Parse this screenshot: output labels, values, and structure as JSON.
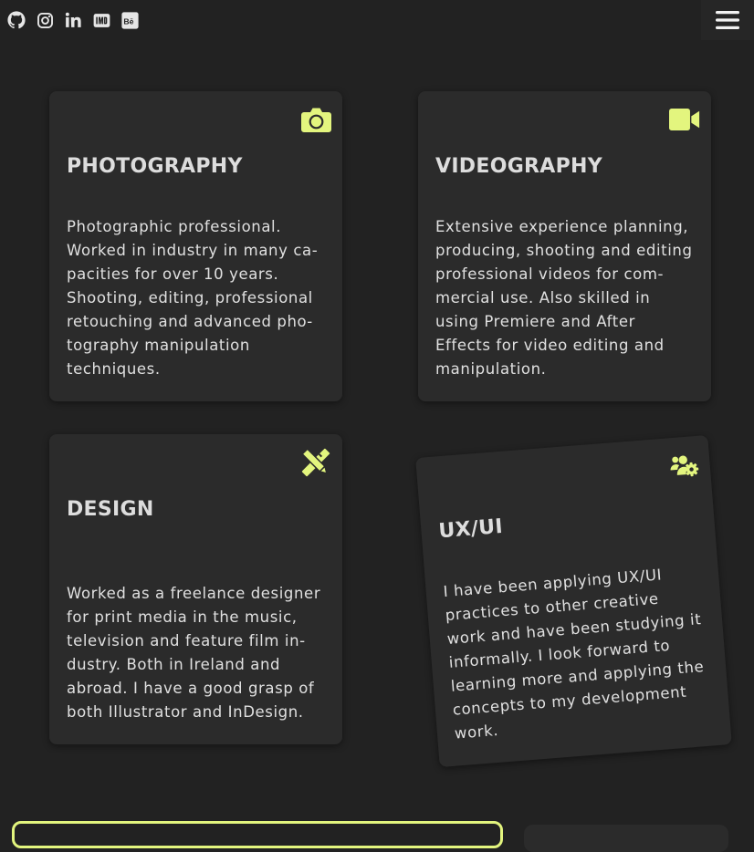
{
  "colors": {
    "background": "#222222",
    "card": "#2b2b2b",
    "accent": "#e3f57e",
    "text": "#e0e0e0"
  },
  "social_links": [
    {
      "icon": "github-icon"
    },
    {
      "icon": "instagram-icon"
    },
    {
      "icon": "linkedin-icon"
    },
    {
      "icon": "imdb-icon"
    },
    {
      "icon": "behance-icon"
    }
  ],
  "menu": {
    "icon": "hamburger-menu-icon"
  },
  "cards": {
    "photography": {
      "icon": "camera-icon",
      "title": "PHOTOGRAPHY",
      "text": "Photographic professional. Worked in industry in many ca­pacities for over 10 years. Shooting, editing, professional retouching and advanced pho­tography manipulation techniques."
    },
    "videography": {
      "icon": "video-camera-icon",
      "title": "VIDEOGRAPHY",
      "text": "Extensive experience planning, producing, shooting and editing professional videos for com­mercial use. Also skilled in using Premiere and After Effects for video editing and manipulation."
    },
    "design": {
      "icon": "pencil-ruler-icon",
      "title": "DESIGN",
      "text": "Worked as a freelance designer for print media in the music, television and feature film in­dustry. Both in Ireland and abroad. I have a good grasp of both Illustrator and InDesign."
    },
    "uxui": {
      "icon": "users-cog-icon",
      "title": "UX/UI",
      "text": "I have been applying UX/UI practices to other creative work and have been studying it in­formally. I look forward to learn­ing more and applying the con­cepts to my development work."
    }
  }
}
